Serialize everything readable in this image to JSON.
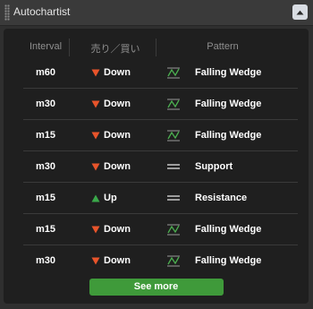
{
  "widget": {
    "title": "Autochartist",
    "collapse_icon": "chevron-up-icon"
  },
  "table": {
    "headers": {
      "interval": "Interval",
      "direction": "売り／買い",
      "pattern": "Pattern"
    },
    "rows": [
      {
        "interval": "m60",
        "direction": "Down",
        "direction_icon": "down-arrow-icon",
        "pattern_icon": "falling-wedge-icon",
        "pattern": "Falling Wedge"
      },
      {
        "interval": "m30",
        "direction": "Down",
        "direction_icon": "down-arrow-icon",
        "pattern_icon": "falling-wedge-icon",
        "pattern": "Falling Wedge"
      },
      {
        "interval": "m15",
        "direction": "Down",
        "direction_icon": "down-arrow-icon",
        "pattern_icon": "falling-wedge-icon",
        "pattern": "Falling Wedge"
      },
      {
        "interval": "m30",
        "direction": "Down",
        "direction_icon": "down-arrow-icon",
        "pattern_icon": "horizontal-level-icon",
        "pattern": "Support"
      },
      {
        "interval": "m15",
        "direction": "Up",
        "direction_icon": "up-arrow-icon",
        "pattern_icon": "horizontal-level-icon",
        "pattern": "Resistance"
      },
      {
        "interval": "m15",
        "direction": "Down",
        "direction_icon": "down-arrow-icon",
        "pattern_icon": "falling-wedge-icon",
        "pattern": "Falling Wedge"
      },
      {
        "interval": "m30",
        "direction": "Down",
        "direction_icon": "down-arrow-icon",
        "pattern_icon": "falling-wedge-icon",
        "pattern": "Falling Wedge"
      }
    ]
  },
  "actions": {
    "see_more_label": "See more"
  },
  "colors": {
    "down": "#e8542b",
    "up": "#3aa84a",
    "button": "#3f9a3a",
    "wedge_icon": "#4caf50",
    "level_icon": "#bdbdbd"
  }
}
